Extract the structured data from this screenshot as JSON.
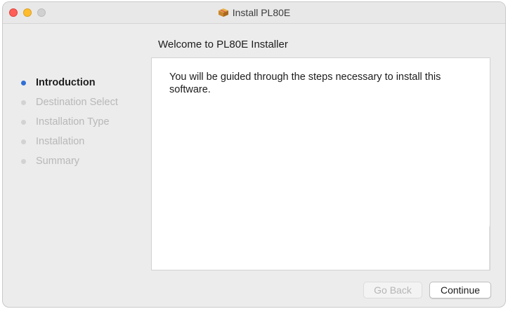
{
  "window": {
    "title": "Install PL80E",
    "title_icon": "package-icon"
  },
  "heading": "Welcome to PL80E Installer",
  "steps": [
    {
      "label": "Introduction",
      "active": true
    },
    {
      "label": "Destination Select",
      "active": false
    },
    {
      "label": "Installation Type",
      "active": false
    },
    {
      "label": "Installation",
      "active": false
    },
    {
      "label": "Summary",
      "active": false
    }
  ],
  "content": {
    "text": "You will be guided through the steps necessary to install this software."
  },
  "buttons": {
    "back_label": "Go Back",
    "back_enabled": false,
    "continue_label": "Continue"
  },
  "colors": {
    "active_step_dot": "#2f6fd6",
    "close": "#ff5f57",
    "minimize": "#febc2e",
    "zoom_inactive": "#d0d0d0"
  }
}
